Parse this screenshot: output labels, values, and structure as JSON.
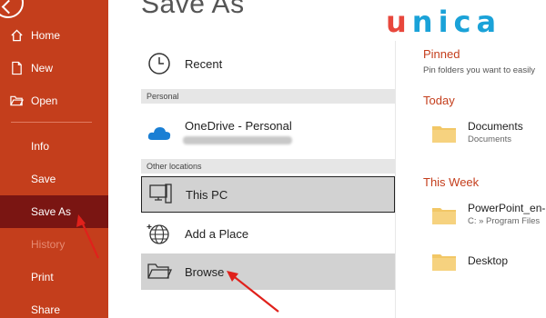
{
  "sidebar": {
    "items": [
      {
        "label": "Home",
        "icon": "home-icon"
      },
      {
        "label": "New",
        "icon": "new-document-icon"
      },
      {
        "label": "Open",
        "icon": "open-folder-icon"
      },
      {
        "label": "Info"
      },
      {
        "label": "Save"
      },
      {
        "label": "Save As"
      },
      {
        "label": "History"
      },
      {
        "label": "Print"
      },
      {
        "label": "Share"
      }
    ],
    "accent_color": "#c43e1c",
    "active_color": "#7a1512"
  },
  "main": {
    "title": "Save As",
    "recent_label": "Recent",
    "personal_header": "Personal",
    "onedrive_label": "OneDrive - Personal",
    "other_locations_header": "Other locations",
    "this_pc_label": "This PC",
    "add_place_label": "Add a Place",
    "browse_label": "Browse"
  },
  "right": {
    "pinned_header": "Pinned",
    "pinned_sub": "Pin folders you want to easily",
    "today_header": "Today",
    "this_week_header": "This Week",
    "folders": [
      {
        "name": "Documents",
        "path": "Documents"
      },
      {
        "name": "PowerPoint_en-",
        "path": "C: » Program Files"
      },
      {
        "name": "Desktop",
        "path": ""
      }
    ]
  },
  "logo": {
    "u": "u",
    "rest": "nica"
  }
}
